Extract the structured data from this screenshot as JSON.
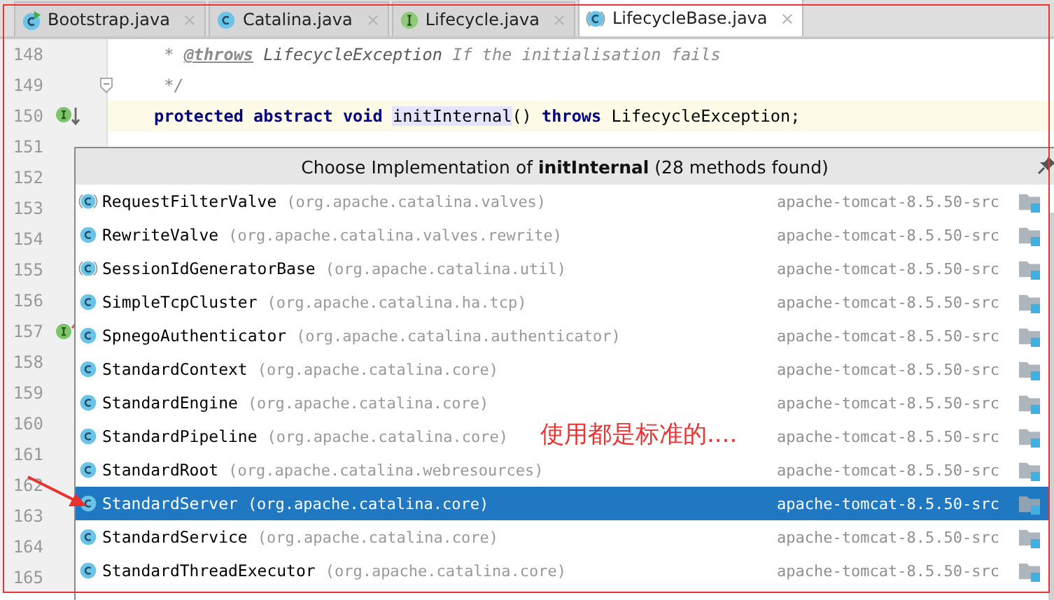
{
  "tabs": [
    {
      "label": "Bootstrap.java",
      "kind": "runnable-class",
      "selected": false
    },
    {
      "label": "Catalina.java",
      "kind": "class",
      "selected": false
    },
    {
      "label": "Lifecycle.java",
      "kind": "interface",
      "selected": false
    },
    {
      "label": "LifecycleBase.java",
      "kind": "abstract-class",
      "selected": true
    }
  ],
  "editor": {
    "lines": [
      {
        "number": "148",
        "kind": "plain",
        "current": false,
        "segments": [
          {
            "kind": "comment",
            "text": " * "
          },
          {
            "kind": "doc-tag",
            "text": "@throws"
          },
          {
            "kind": "comment-ref",
            "text": " LifecycleException"
          },
          {
            "kind": "comment",
            "text": " If the initialisation fails"
          }
        ]
      },
      {
        "number": "149",
        "kind": "fold",
        "current": false,
        "segments": [
          {
            "kind": "comment",
            "text": " */"
          }
        ]
      },
      {
        "number": "150",
        "kind": "implemented",
        "current": true,
        "segments": [
          {
            "kind": "keyword",
            "text": "protected abstract void "
          },
          {
            "kind": "usage",
            "text": "initInternal"
          },
          {
            "kind": "plain",
            "text": "() "
          },
          {
            "kind": "keyword",
            "text": "throws"
          },
          {
            "kind": "plain",
            "text": " LifecycleException;"
          }
        ]
      },
      {
        "number": "151",
        "kind": "plain"
      },
      {
        "number": "152",
        "kind": "plain"
      },
      {
        "number": "153",
        "kind": "plain"
      },
      {
        "number": "154",
        "kind": "plain"
      },
      {
        "number": "155",
        "kind": "plain"
      },
      {
        "number": "156",
        "kind": "plain"
      },
      {
        "number": "157",
        "kind": "implements"
      },
      {
        "number": "158",
        "kind": "plain"
      },
      {
        "number": "159",
        "kind": "plain"
      },
      {
        "number": "160",
        "kind": "plain"
      },
      {
        "number": "161",
        "kind": "plain"
      },
      {
        "number": "162",
        "kind": "plain"
      },
      {
        "number": "163",
        "kind": "plain"
      },
      {
        "number": "164",
        "kind": "plain"
      },
      {
        "number": "165",
        "kind": "plain"
      }
    ]
  },
  "popup": {
    "title": "Choose Implementation of **initInternal** (28 methods found)",
    "items": [
      {
        "name": "RequestFilterValve",
        "package": "(org.apache.catalina.valves)",
        "location": "apache-tomcat-8.5.50-src",
        "kind": "abstract-class",
        "selected": false
      },
      {
        "name": "RewriteValve",
        "package": "(org.apache.catalina.valves.rewrite)",
        "location": "apache-tomcat-8.5.50-src",
        "kind": "class",
        "selected": false
      },
      {
        "name": "SessionIdGeneratorBase",
        "package": "(org.apache.catalina.util)",
        "location": "apache-tomcat-8.5.50-src",
        "kind": "abstract-class",
        "selected": false
      },
      {
        "name": "SimpleTcpCluster",
        "package": "(org.apache.catalina.ha.tcp)",
        "location": "apache-tomcat-8.5.50-src",
        "kind": "class",
        "selected": false
      },
      {
        "name": "SpnegoAuthenticator",
        "package": "(org.apache.catalina.authenticator)",
        "location": "apache-tomcat-8.5.50-src",
        "kind": "class",
        "selected": false
      },
      {
        "name": "StandardContext",
        "package": "(org.apache.catalina.core)",
        "location": "apache-tomcat-8.5.50-src",
        "kind": "class",
        "selected": false
      },
      {
        "name": "StandardEngine",
        "package": "(org.apache.catalina.core)",
        "location": "apache-tomcat-8.5.50-src",
        "kind": "class",
        "selected": false
      },
      {
        "name": "StandardPipeline",
        "package": "(org.apache.catalina.core)",
        "location": "apache-tomcat-8.5.50-src",
        "kind": "class",
        "selected": false
      },
      {
        "name": "StandardRoot",
        "package": "(org.apache.catalina.webresources)",
        "location": "apache-tomcat-8.5.50-src",
        "kind": "class",
        "selected": false
      },
      {
        "name": "StandardServer",
        "package": "(org.apache.catalina.core)",
        "location": "apache-tomcat-8.5.50-src",
        "kind": "class",
        "selected": true
      },
      {
        "name": "StandardService",
        "package": "(org.apache.catalina.core)",
        "location": "apache-tomcat-8.5.50-src",
        "kind": "class",
        "selected": false
      },
      {
        "name": "StandardThreadExecutor",
        "package": "(org.apache.catalina.core)",
        "location": "apache-tomcat-8.5.50-src",
        "kind": "class",
        "selected": false
      }
    ]
  },
  "annotation": {
    "text": "使用都是标准的...."
  }
}
